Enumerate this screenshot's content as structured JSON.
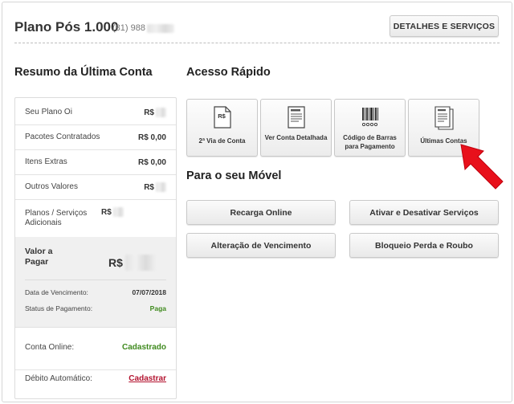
{
  "header": {
    "plan_title": "Plano Pós 1.000",
    "phone": "(81) 988",
    "details_button": "DETALHES E SERVIÇOS"
  },
  "summary": {
    "title": "Resumo da Última Conta",
    "rows": [
      {
        "label": "Seu Plano Oi",
        "value": "R$",
        "masked": true
      },
      {
        "label": "Pacotes Contratados",
        "value": "R$ 0,00",
        "masked": false
      },
      {
        "label": "Itens Extras",
        "value": "R$ 0,00",
        "masked": false
      },
      {
        "label": "Outros Valores",
        "value": "R$",
        "masked": true
      },
      {
        "label": "Planos / Serviços Adicionais",
        "value": "R$",
        "masked": true
      }
    ],
    "payment": {
      "label": "Valor a Pagar",
      "value": "R$",
      "due_label": "Data de Vencimento:",
      "due_value": "07/07/2018",
      "status_label": "Status de Pagamento:",
      "status_value": "Paga"
    },
    "online": {
      "label": "Conta Online:",
      "value": "Cadastrado"
    },
    "autodebit": {
      "label": "Débito Automático:",
      "value": "Cadastrar"
    }
  },
  "quick_access": {
    "title": "Acesso Rápido",
    "items": [
      {
        "label": "2ª Via de Conta",
        "icon": "rs-document-icon"
      },
      {
        "label": "Ver Conta Detalhada",
        "icon": "detailed-document-icon"
      },
      {
        "label": "Código de Barras para Pagamento",
        "icon": "barcode-icon"
      },
      {
        "label": "Últimas Contas",
        "icon": "stacked-documents-icon"
      }
    ]
  },
  "mobile": {
    "title": "Para o seu Móvel",
    "buttons": [
      "Recarga Online",
      "Ativar e Desativar Serviços",
      "Alteração de Vencimento",
      "Bloqueio Perda e Roubo"
    ]
  },
  "colors": {
    "status_green": "#3f8a1e",
    "link_red": "#b3122e",
    "arrow_red": "#e8101b"
  }
}
